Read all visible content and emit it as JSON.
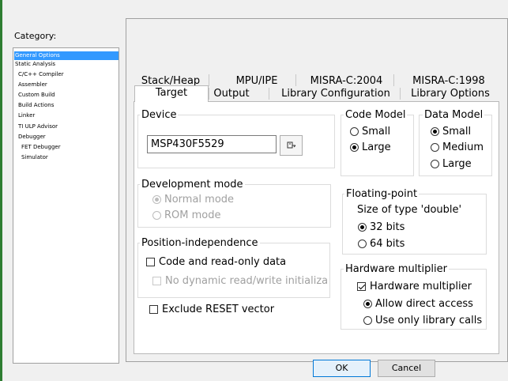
{
  "category": {
    "label": "Category:",
    "items": [
      {
        "label": "General Options",
        "selected": true
      },
      {
        "label": "Static Analysis"
      },
      {
        "label": "C/C++ Compiler"
      },
      {
        "label": "Assembler"
      },
      {
        "label": "Custom Build"
      },
      {
        "label": "Build Actions"
      },
      {
        "label": "Linker"
      },
      {
        "label": "TI ULP Advisor"
      },
      {
        "label": "Debugger"
      },
      {
        "label": "FET Debugger"
      },
      {
        "label": "Simulator"
      }
    ]
  },
  "tabs": {
    "row1": [
      "Stack/Heap",
      "MPU/IPE",
      "MISRA-C:2004",
      "MISRA-C:1998"
    ],
    "row2": [
      "Target",
      "Output",
      "Library Configuration",
      "Library Options"
    ],
    "active": "Target"
  },
  "device": {
    "title": "Device",
    "value": "MSP430F5529",
    "browse_icon": "browse-device-icon"
  },
  "code_model": {
    "title": "Code Model",
    "options": [
      "Small",
      "Large"
    ],
    "selected": "Large"
  },
  "data_model": {
    "title": "Data Model",
    "options": [
      "Small",
      "Medium",
      "Large"
    ],
    "selected": "Small"
  },
  "development_mode": {
    "title": "Development mode",
    "options": [
      "Normal mode",
      "ROM mode"
    ],
    "selected": "Normal mode",
    "disabled": true
  },
  "floating_point": {
    "title": "Floating-point",
    "label": "Size of type 'double'",
    "options": [
      "32 bits",
      "64 bits"
    ],
    "selected": "32 bits"
  },
  "position_independence": {
    "title": "Position-independence",
    "code_ro_label": "Code and read-only data",
    "code_ro_checked": false,
    "no_dynamic_label": "No dynamic read/write initializatior",
    "no_dynamic_checked": false
  },
  "hardware_multiplier": {
    "title": "Hardware multiplier",
    "checkbox_label": "Hardware multiplier",
    "checked": true,
    "options": [
      "Allow direct access",
      "Use only library calls"
    ],
    "selected": "Allow direct access"
  },
  "exclude_reset": {
    "label": "Exclude RESET vector",
    "checked": false
  },
  "buttons": {
    "ok": "OK",
    "cancel": "Cancel"
  }
}
